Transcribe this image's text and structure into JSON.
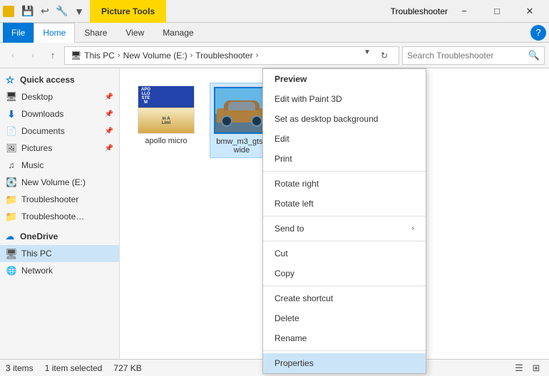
{
  "titleBar": {
    "pictureTool": "Picture Tools",
    "appTitle": "Troubleshooter",
    "minimizeLabel": "−",
    "maximizeLabel": "□",
    "closeLabel": "✕",
    "helpLabel": "?"
  },
  "ribbon": {
    "tabs": [
      "File",
      "Home",
      "Share",
      "View",
      "Manage"
    ]
  },
  "addressBar": {
    "backBtn": "‹",
    "forwardBtn": "›",
    "upBtn": "↑",
    "pathParts": [
      "This PC",
      "New Volume (E:)",
      "Troubleshooter"
    ],
    "refreshBtn": "↻",
    "searchPlaceholder": "Search Troubleshooter"
  },
  "sidebar": {
    "quickAccess": "Quick access",
    "items": [
      {
        "label": "Desktop",
        "pinned": true,
        "type": "folder"
      },
      {
        "label": "Downloads",
        "pinned": true,
        "type": "download"
      },
      {
        "label": "Documents",
        "pinned": true,
        "type": "doc"
      },
      {
        "label": "Pictures",
        "pinned": true,
        "type": "pic"
      },
      {
        "label": "Music",
        "pinned": false,
        "type": "music"
      },
      {
        "label": "New Volume (E:)",
        "pinned": false,
        "type": "drive"
      },
      {
        "label": "Troubleshooter",
        "pinned": false,
        "type": "folder"
      },
      {
        "label": "Troubleshooter Wor",
        "pinned": false,
        "type": "folder"
      }
    ],
    "oneDrive": "OneDrive",
    "thisPC": "This PC",
    "network": "Network"
  },
  "files": [
    {
      "name": "apollo micro",
      "type": "apollo"
    },
    {
      "name": "bmw_m3_gts_wide",
      "type": "bmw",
      "selected": true
    }
  ],
  "contextMenu": {
    "items": [
      {
        "label": "Preview",
        "bold": true,
        "highlighted": false
      },
      {
        "label": "Edit with Paint 3D",
        "bold": false
      },
      {
        "label": "Set as desktop background",
        "bold": false
      },
      {
        "label": "Edit",
        "bold": false
      },
      {
        "label": "Print",
        "bold": false
      },
      {
        "separator": true
      },
      {
        "label": "Rotate right",
        "bold": false
      },
      {
        "label": "Rotate left",
        "bold": false
      },
      {
        "separator": true
      },
      {
        "label": "Send to",
        "bold": false,
        "arrow": true
      },
      {
        "separator": true
      },
      {
        "label": "Cut",
        "bold": false
      },
      {
        "label": "Copy",
        "bold": false
      },
      {
        "separator": true
      },
      {
        "label": "Create shortcut",
        "bold": false
      },
      {
        "label": "Delete",
        "bold": false
      },
      {
        "label": "Rename",
        "bold": false
      },
      {
        "separator": true
      },
      {
        "label": "Properties",
        "bold": false,
        "highlighted": true
      }
    ]
  },
  "statusBar": {
    "itemCount": "3 items",
    "selectedInfo": "1 item selected",
    "fileSize": "727 KB"
  }
}
